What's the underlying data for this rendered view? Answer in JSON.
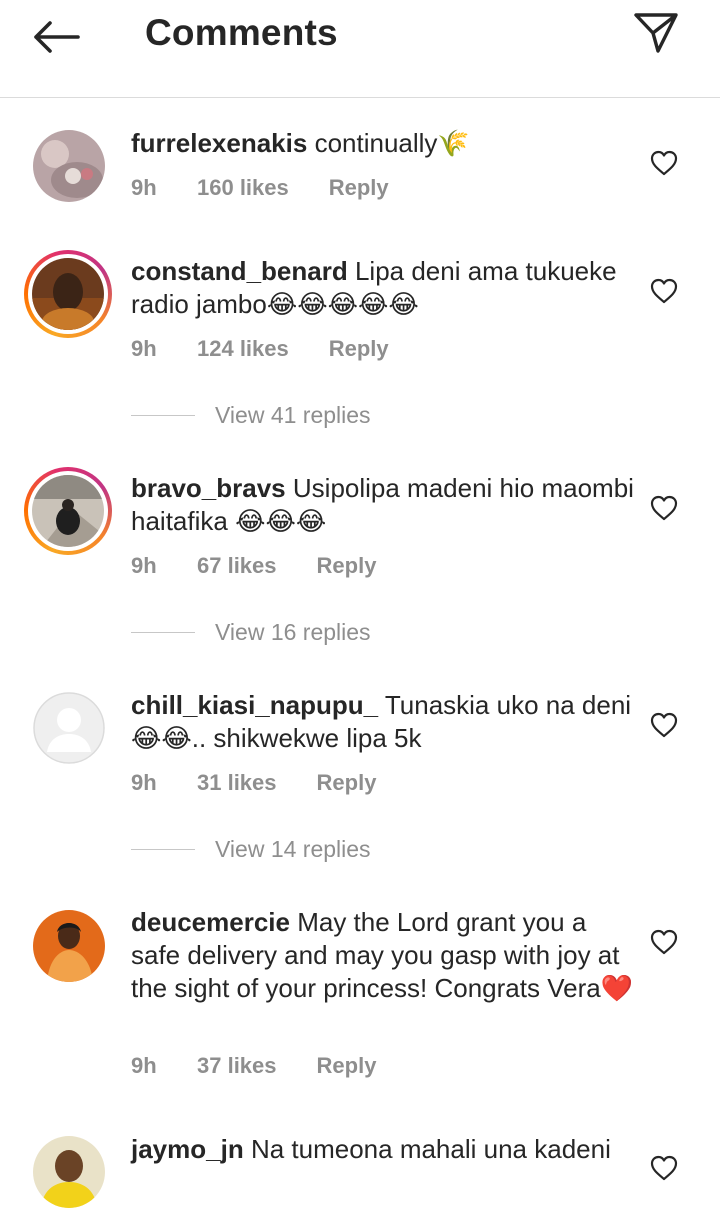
{
  "header": {
    "title": "Comments",
    "back_icon": "arrow-left-icon",
    "send_icon": "paper-plane-icon"
  },
  "comments": [
    {
      "username": "furrelexenakis",
      "text": "continually🌾",
      "time": "9h",
      "likes": "160 likes",
      "reply": "Reply",
      "story_ring": false
    },
    {
      "username": "constand_benard",
      "text": "Lipa deni ama tukueke radio jambo😂😂😂😂😂",
      "time": "9h",
      "likes": "124 likes",
      "reply": "Reply",
      "view_replies": "View 41 replies",
      "story_ring": true
    },
    {
      "username": "bravo_bravs",
      "text": "Usipolipa madeni hio maombi haitafika 😂😂😂",
      "time": "9h",
      "likes": "67 likes",
      "reply": "Reply",
      "view_replies": "View 16 replies",
      "story_ring": true
    },
    {
      "username": "chill_kiasi_napupu_",
      "text": "Tunaskia uko na deni😂😂.. shikwekwe lipa 5k",
      "time": "9h",
      "likes": "31 likes",
      "reply": "Reply",
      "view_replies": "View 14 replies",
      "story_ring": false
    },
    {
      "username": "deucemercie",
      "text": "May the Lord grant you a safe delivery and may you gasp with joy at the sight of your princess! Congrats Vera❤️",
      "time": "9h",
      "likes": "37 likes",
      "reply": "Reply",
      "story_ring": false
    },
    {
      "username": "jaymo_jn",
      "text": "Na tumeona mahali una kadeni",
      "story_ring": false
    }
  ],
  "colors": {
    "text": "#262626",
    "meta": "#8e8e8e",
    "divider": "#dbdbdb"
  }
}
